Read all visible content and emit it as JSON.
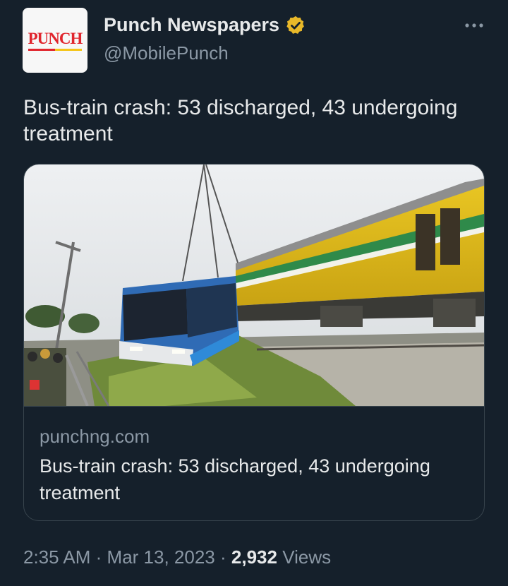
{
  "author": {
    "avatar_logo_text": "PUNCH",
    "display_name": "Punch Newspapers",
    "handle": "@MobilePunch",
    "verified_badge_color": "#e8b829",
    "verified_badge_icon": "verified-badge-icon"
  },
  "more_icon": "more-horizontal-icon",
  "tweet": {
    "text": "Bus-train crash: 53 discharged, 43 undergoing treatment"
  },
  "link_card": {
    "image_subject": "bus-train-crash-photo",
    "domain": "punchng.com",
    "title": "Bus-train crash: 53 discharged, 43 undergoing treatment"
  },
  "meta": {
    "time": "2:35 AM",
    "separator": "·",
    "date": "Mar 13, 2023",
    "views_count": "2,932",
    "views_label": "Views"
  },
  "colors": {
    "background": "#15202b",
    "primary_text": "#e7e9ea",
    "secondary_text": "#8b98a5",
    "border": "#38444d",
    "brand_red": "#e0252d"
  }
}
